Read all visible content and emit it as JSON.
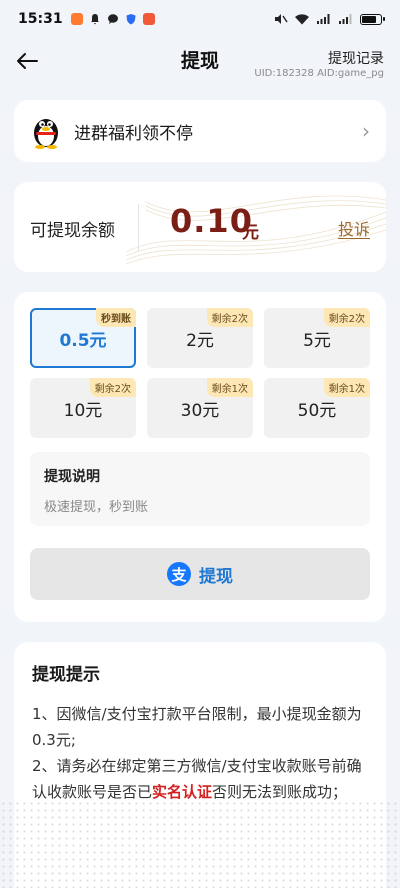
{
  "status_bar": {
    "time": "15:31"
  },
  "header": {
    "title": "提现",
    "record": "提现记录",
    "uid_line": "UID:182328 AID:game_pg"
  },
  "group": {
    "text": "进群福利领不停"
  },
  "balance": {
    "label": "可提现余额",
    "amount": "0.10",
    "unit": "元",
    "complain": "投诉"
  },
  "options": [
    {
      "amount": "0.5元",
      "badge": "秒到账",
      "selected": true
    },
    {
      "amount": "2元",
      "badge": "剩余2次",
      "selected": false
    },
    {
      "amount": "5元",
      "badge": "剩余2次",
      "selected": false
    },
    {
      "amount": "10元",
      "badge": "剩余2次",
      "selected": false
    },
    {
      "amount": "30元",
      "badge": "剩余1次",
      "selected": false
    },
    {
      "amount": "50元",
      "badge": "剩余1次",
      "selected": false
    }
  ],
  "explain": {
    "title": "提现说明",
    "text": "极速提现，秒到账"
  },
  "withdraw_button": {
    "label": "提现",
    "icon": "alipay-icon"
  },
  "tips": {
    "title": "提现提示",
    "line1": "1、因微信/支付宝打款平台限制，最小提现金额为0.3元;",
    "line2_pre": "2、请务必在绑定第三方微信/支付宝收款账号前确认收款账号是否已",
    "line2_red": "实名认证",
    "line2_post": "否则无法到账成功；"
  },
  "colors": {
    "accent_blue": "#1f78d1",
    "balance_red": "#7b1f16",
    "badge_bg": "#fde7b4",
    "warning_red": "#d42020"
  }
}
